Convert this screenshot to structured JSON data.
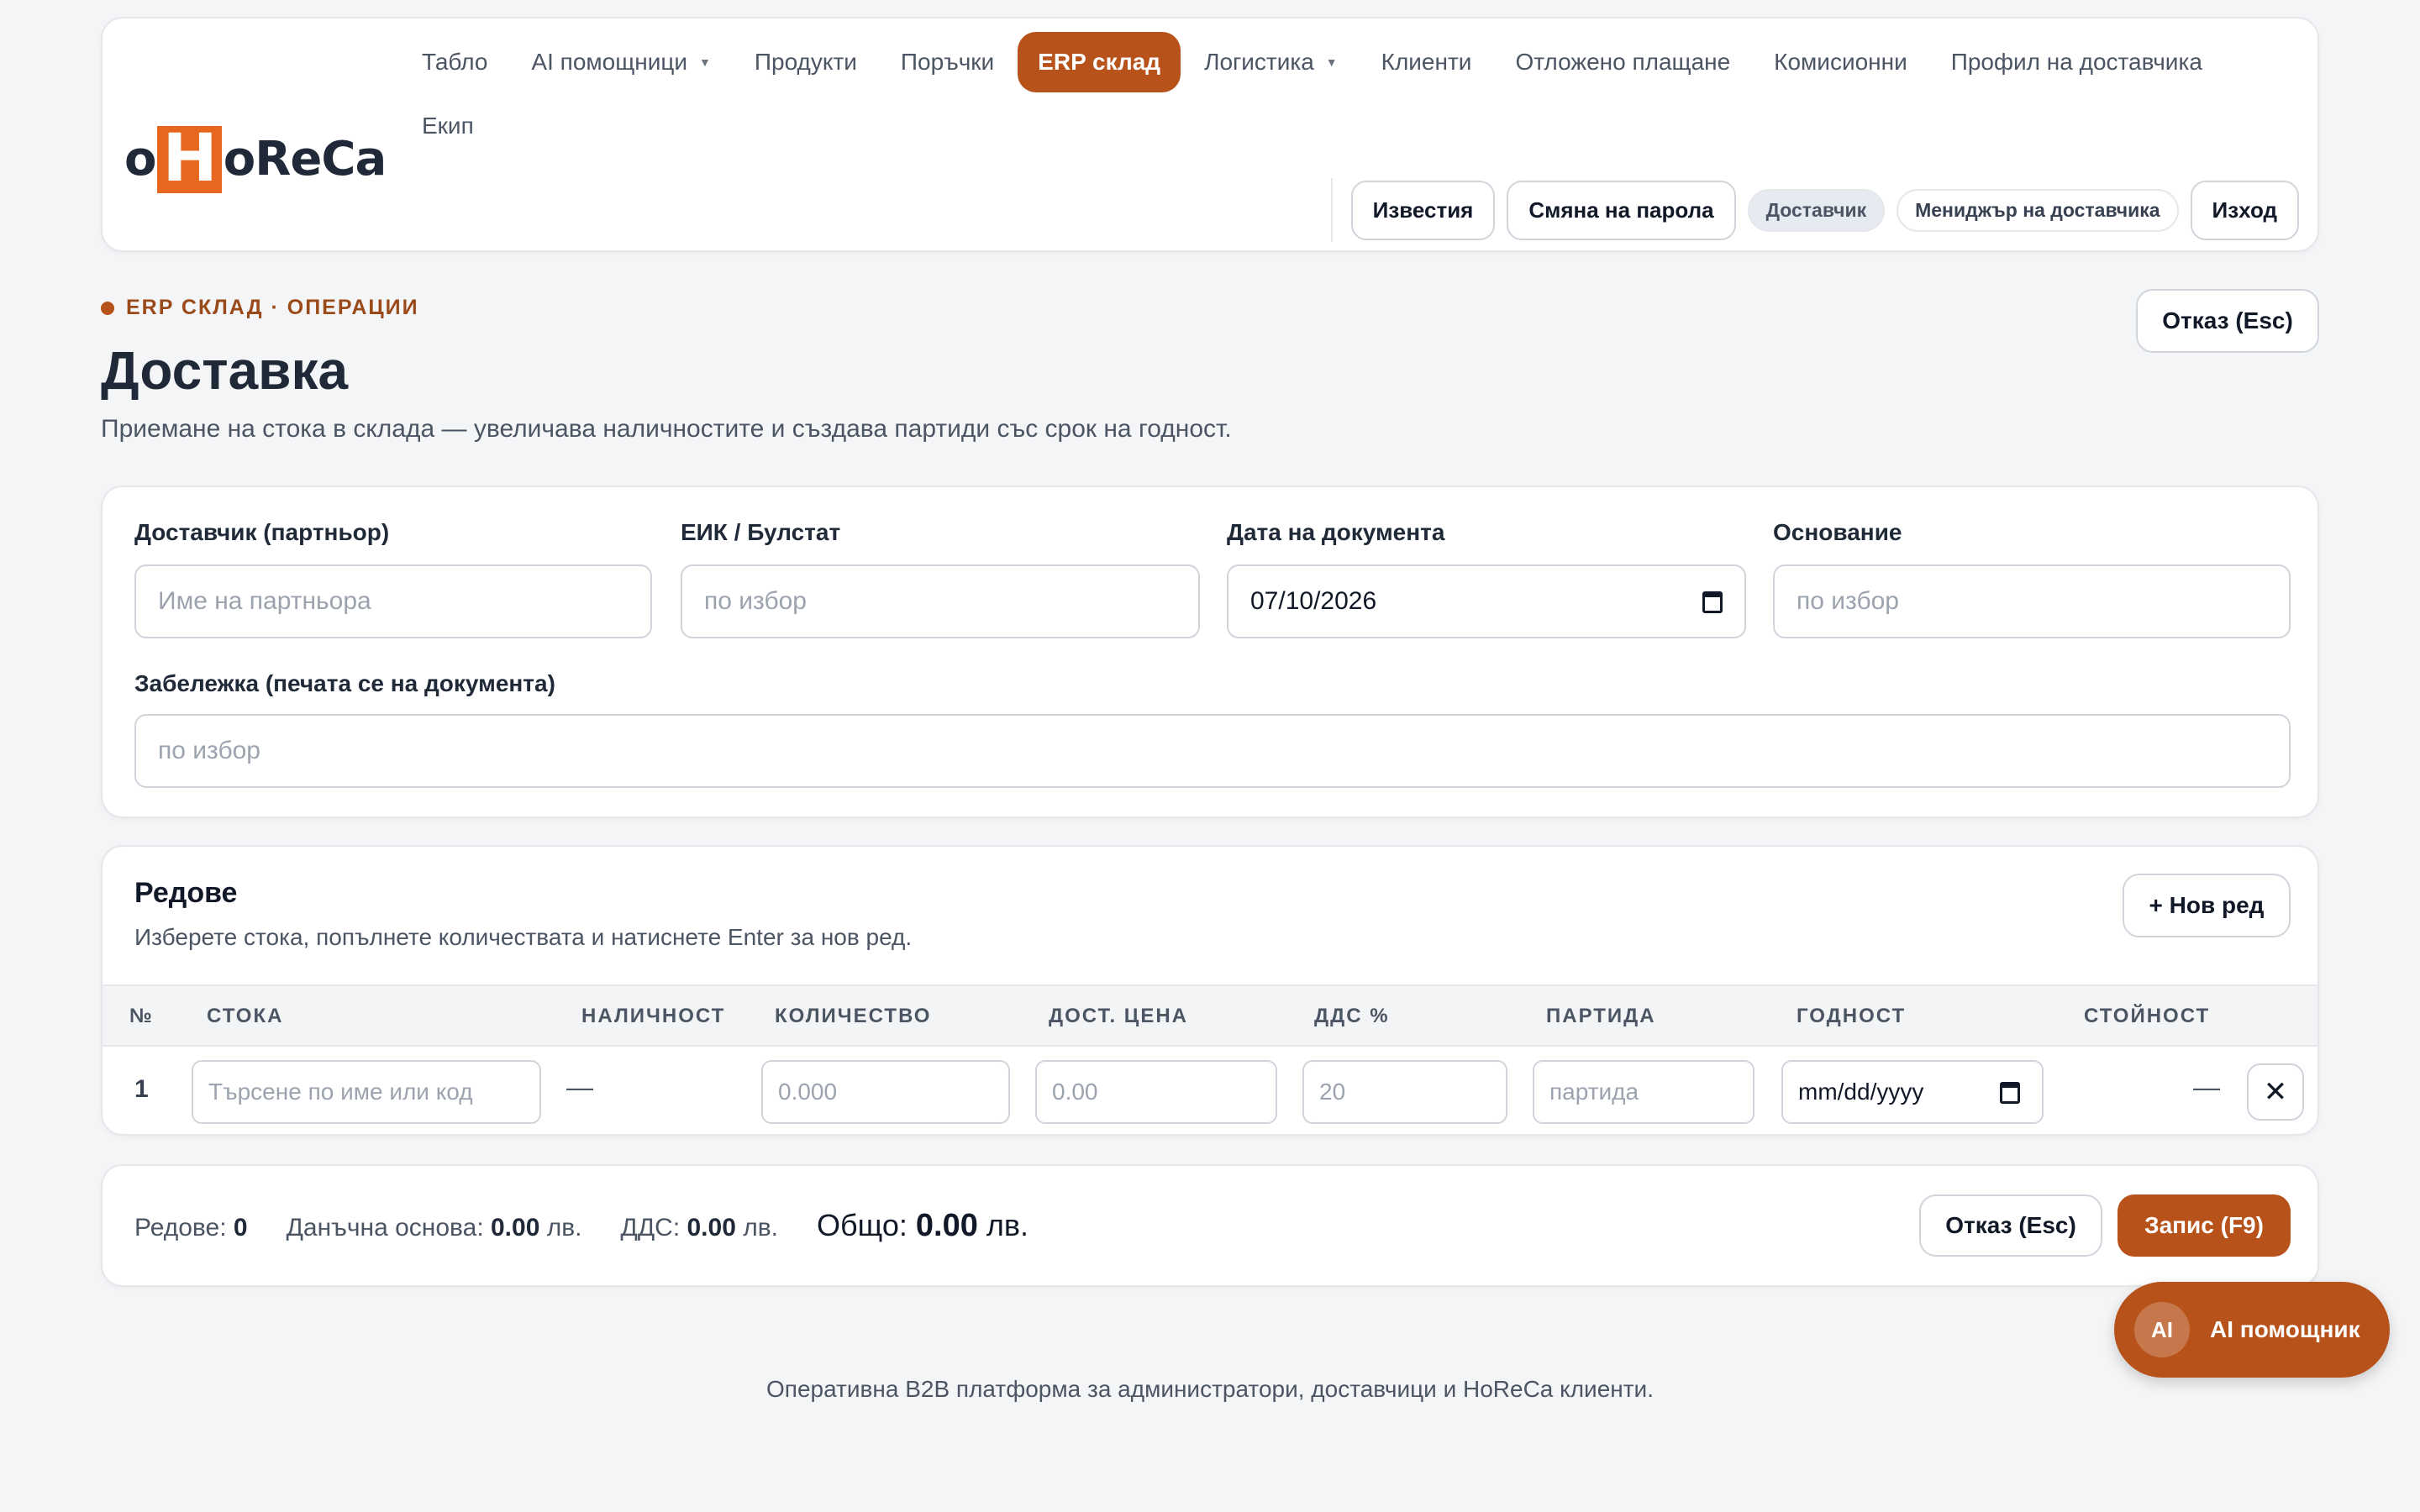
{
  "brand": {
    "logo_o": "o",
    "logo_h": "H",
    "logo_rest": "oReCa"
  },
  "nav": {
    "items": [
      {
        "label": "Табло"
      },
      {
        "label": "AI помощници",
        "dropdown": true
      },
      {
        "label": "Продукти"
      },
      {
        "label": "Поръчки"
      },
      {
        "label": "ERP склад",
        "active": true
      },
      {
        "label": "Логистика",
        "dropdown": true
      },
      {
        "label": "Клиенти"
      },
      {
        "label": "Отложено плащане"
      },
      {
        "label": "Комисионни"
      },
      {
        "label": "Профил на доставчика"
      },
      {
        "label": "Екип"
      }
    ]
  },
  "header_actions": {
    "notifications": "Известия",
    "change_password": "Смяна на парола",
    "role_badge": "Доставчик",
    "role_badge2": "Мениджър на доставчика",
    "logout": "Изход"
  },
  "page": {
    "eyebrow": "ERP СКЛАД · ОПЕРАЦИИ",
    "title": "Доставка",
    "subtitle": "Приемане на стока в склада — увеличава наличностите и създава партиди със срок на годност.",
    "cancel_top": "Отказ (Esc)"
  },
  "form": {
    "supplier_label": "Доставчик (партньор)",
    "supplier_placeholder": "Име на партньора",
    "eik_label": "ЕИК / Булстат",
    "eik_placeholder": "по избор",
    "date_label": "Дата на документа",
    "date_value": "07/10/2026",
    "basis_label": "Основание",
    "basis_placeholder": "по избор",
    "note_label": "Забележка (печата се на документа)",
    "note_placeholder": "по избор"
  },
  "lines": {
    "title": "Редове",
    "description": "Изберете стока, попълнете количествата и натиснете Enter за нов ред.",
    "new_row": "+ Нов ред",
    "columns": {
      "num": "№",
      "item": "СТОКА",
      "stock": "НАЛИЧНОСТ",
      "qty": "КОЛИЧЕСТВО",
      "price": "ДОСТ. ЦЕНА",
      "vat": "ДДС %",
      "batch": "ПАРТИДА",
      "expiry": "ГОДНОСТ",
      "value": "СТОЙНОСТ"
    },
    "rows": [
      {
        "num": "1",
        "item_placeholder": "Търсене по име или код",
        "stock": "—",
        "qty_placeholder": "0.000",
        "price_placeholder": "0.00",
        "vat_value": "20",
        "batch_placeholder": "партида",
        "expiry_placeholder": "mm/dd/yyyy",
        "value": "—",
        "remove": "✕"
      }
    ]
  },
  "totals": {
    "rows_label": "Редове:",
    "rows_value": "0",
    "base_label": "Данъчна основа:",
    "base_value": "0.00",
    "vat_label": "ДДС:",
    "vat_value": "0.00",
    "total_label": "Общо:",
    "total_value": "0.00",
    "currency": "лв.",
    "cancel": "Отказ (Esc)",
    "save": "Запис (F9)"
  },
  "ai_fab": {
    "badge": "AI",
    "label": "AI помощник"
  },
  "footer": {
    "text": "Оперативна B2B платформа за администратори, доставчици и HoReCa клиенти."
  },
  "colors": {
    "accent": "#b7521a",
    "logo_orange": "#e8671e",
    "background": "#f4f5f7"
  }
}
